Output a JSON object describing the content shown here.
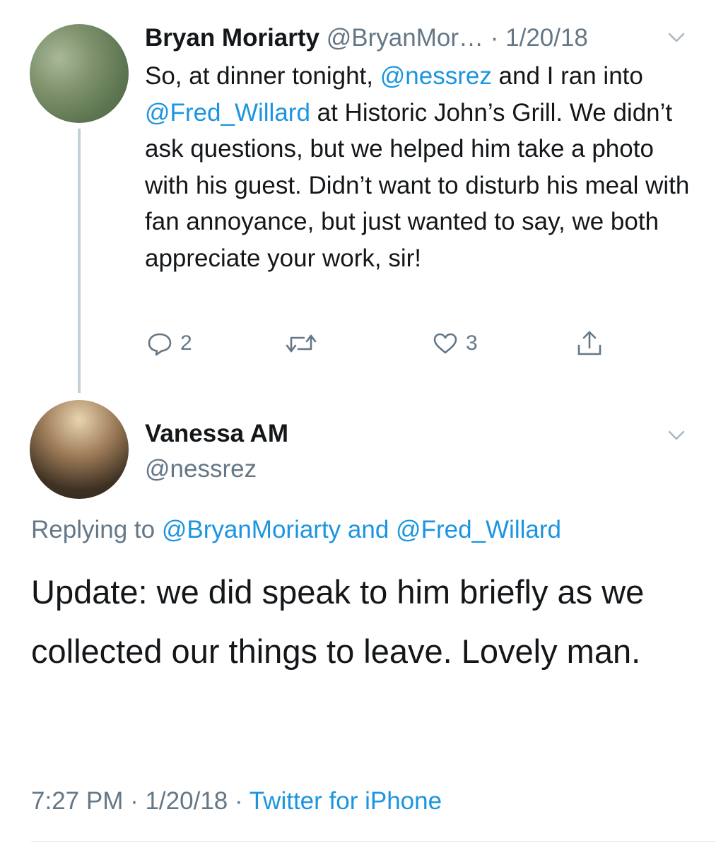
{
  "tweet1": {
    "display_name": "Bryan Moriarty",
    "handle": "@BryanMor…",
    "separator": " · ",
    "date": "1/20/18",
    "body": [
      {
        "text": "So, at dinner tonight, ",
        "type": "text"
      },
      {
        "text": "@nessrez",
        "type": "mention"
      },
      {
        "text": " and I ran into ",
        "type": "text"
      },
      {
        "text": "@Fred_Willard",
        "type": "mention"
      },
      {
        "text": " at Historic John’s Grill. We didn’t ask questions, but we helped him take a photo with his guest. Didn’t want to disturb his meal with fan annoyance, but just wanted to say, we both appreciate your work, sir!",
        "type": "text"
      }
    ],
    "reply_count": "2",
    "retweet_count": "",
    "like_count": "3"
  },
  "tweet2": {
    "display_name": "Vanessa AM",
    "handle": "@nessrez",
    "replying_prefix": "Replying to ",
    "replying_user1": "@BryanMoriarty",
    "replying_and": " and ",
    "replying_user2": "@Fred_Willard",
    "body": "Update: we did speak to him briefly as we collected our things to leave. Lovely man.",
    "time": "7:27 PM",
    "sep1": " · ",
    "date": "1/20/18",
    "sep2": " · ",
    "source": "Twitter for iPhone"
  },
  "icons": {
    "reply": "reply-icon",
    "retweet": "retweet-icon",
    "like": "heart-icon",
    "share": "share-icon",
    "menu": "chevron-down-icon"
  },
  "colors": {
    "text": "#14171a",
    "muted": "#657786",
    "link": "#1b95e0",
    "thread_line": "#c4cfd6"
  }
}
